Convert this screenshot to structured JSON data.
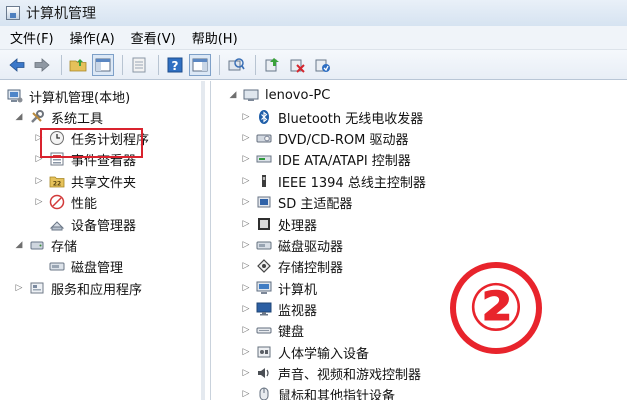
{
  "window": {
    "title": "计算机管理"
  },
  "menu": [
    "文件(F)",
    "操作(A)",
    "查看(V)",
    "帮助(H)"
  ],
  "toolbar": {
    "icons": [
      "back-arrow-icon",
      "forward-arrow-icon",
      "up-folder-icon",
      "console-tree-icon",
      "properties-page-icon",
      "help-icon",
      "action-pane-icon",
      "scan-hardware-icon",
      "update-driver-icon",
      "disable-device-icon",
      "uninstall-device-icon"
    ]
  },
  "tree": {
    "root": "计算机管理(本地)",
    "system_tools": "系统工具",
    "task_scheduler": "任务计划程序",
    "event_viewer": "事件查看器",
    "shared_folders": "共享文件夹",
    "performance": "性能",
    "device_manager": "设备管理器",
    "storage": "存储",
    "disk_management": "磁盘管理",
    "services_apps": "服务和应用程序"
  },
  "devices": {
    "computer_name": "lenovo-PC",
    "categories": [
      "Bluetooth 无线电收发器",
      "DVD/CD-ROM 驱动器",
      "IDE ATA/ATAPI 控制器",
      "IEEE 1394 总线主控制器",
      "SD 主适配器",
      "处理器",
      "磁盘驱动器",
      "存储控制器",
      "计算机",
      "监视器",
      "键盘",
      "人体学输入设备",
      "声音、视频和游戏控制器",
      "鼠标和其他指针设备"
    ]
  },
  "annotation": {
    "step_number": "②"
  },
  "colors": {
    "highlight": "#d9232e",
    "badge": "#e8242c"
  }
}
